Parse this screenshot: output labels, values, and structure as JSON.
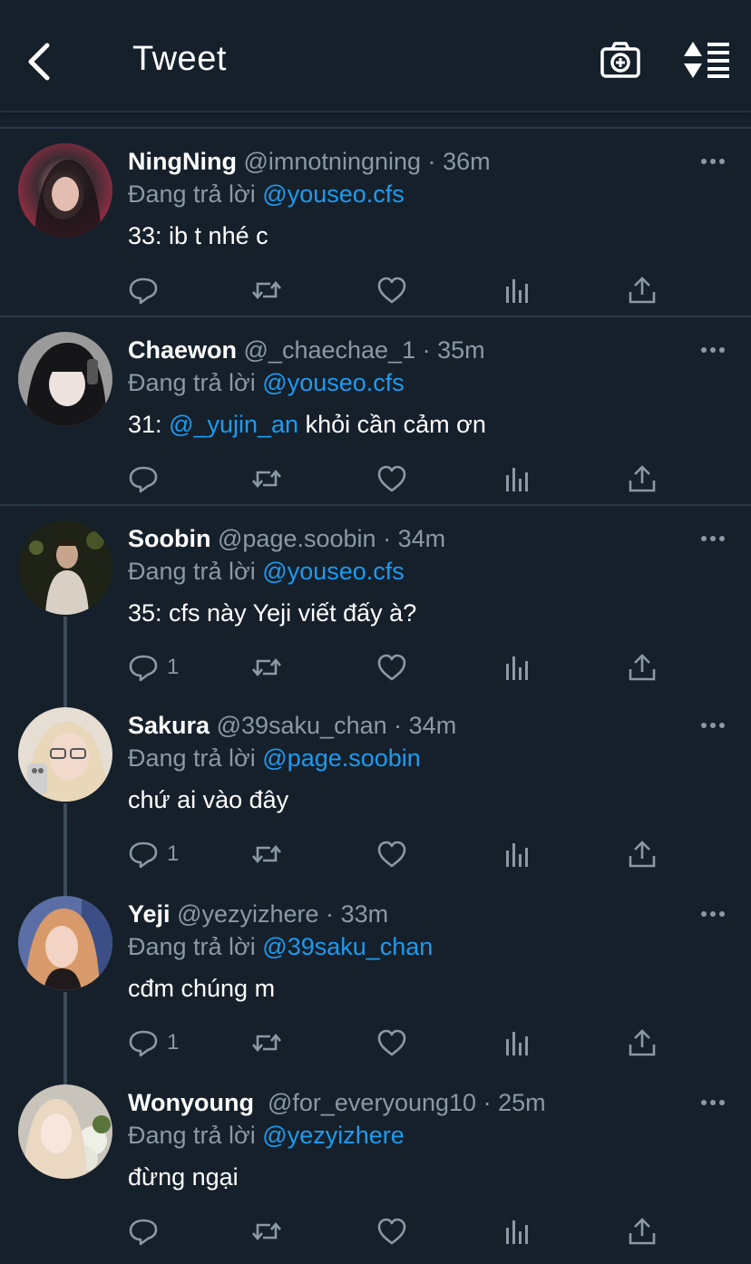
{
  "header": {
    "title": "Tweet",
    "back_icon": "chevron-left-icon",
    "camera_icon": "camera-plus-icon",
    "sort_icon": "sort-list-icon"
  },
  "colors": {
    "background": "#15202b",
    "link": "#1d9bf0",
    "muted": "#8b98a5"
  },
  "tweets": [
    {
      "name": "NingNing",
      "handle": "@imnotningning",
      "time": "36m",
      "reply_prefix": "Đang trả lời",
      "reply_to": "@youseo.cfs",
      "text_prefix": "33: ib t nhé c",
      "text_mention": "",
      "text_suffix": "",
      "reply_count": ""
    },
    {
      "name": "Chaewon",
      "handle": "@_chaechae_1",
      "time": "35m",
      "reply_prefix": "Đang trả lời",
      "reply_to": "@youseo.cfs",
      "text_prefix": "31:",
      "text_mention": "@_yujin_an",
      "text_suffix": "khỏi cần cảm ơn",
      "reply_count": ""
    },
    {
      "name": "Soobin",
      "handle": "@page.soobin",
      "time": "34m",
      "reply_prefix": "Đang trả lời",
      "reply_to": "@youseo.cfs",
      "text_prefix": "35: cfs này Yeji viết đấy à?",
      "text_mention": "",
      "text_suffix": "",
      "reply_count": "1"
    },
    {
      "name": "Sakura",
      "handle": "@39saku_chan",
      "time": "34m",
      "reply_prefix": "Đang trả lời",
      "reply_to": "@page.soobin",
      "text_prefix": "chứ ai vào đây",
      "text_mention": "",
      "text_suffix": "",
      "reply_count": "1"
    },
    {
      "name": "Yeji",
      "handle": "@yezyizhere",
      "time": "33m",
      "reply_prefix": "Đang trả lời",
      "reply_to": "@39saku_chan",
      "text_prefix": "cđm chúng m",
      "text_mention": "",
      "text_suffix": "",
      "reply_count": "1"
    },
    {
      "name": "Wonyoung",
      "handle": "@for_everyoung10",
      "time": "25m",
      "reply_prefix": "Đang trả lời",
      "reply_to": "@yezyizhere",
      "text_prefix": "đừng ngại",
      "text_mention": "",
      "text_suffix": "",
      "reply_count": ""
    }
  ]
}
